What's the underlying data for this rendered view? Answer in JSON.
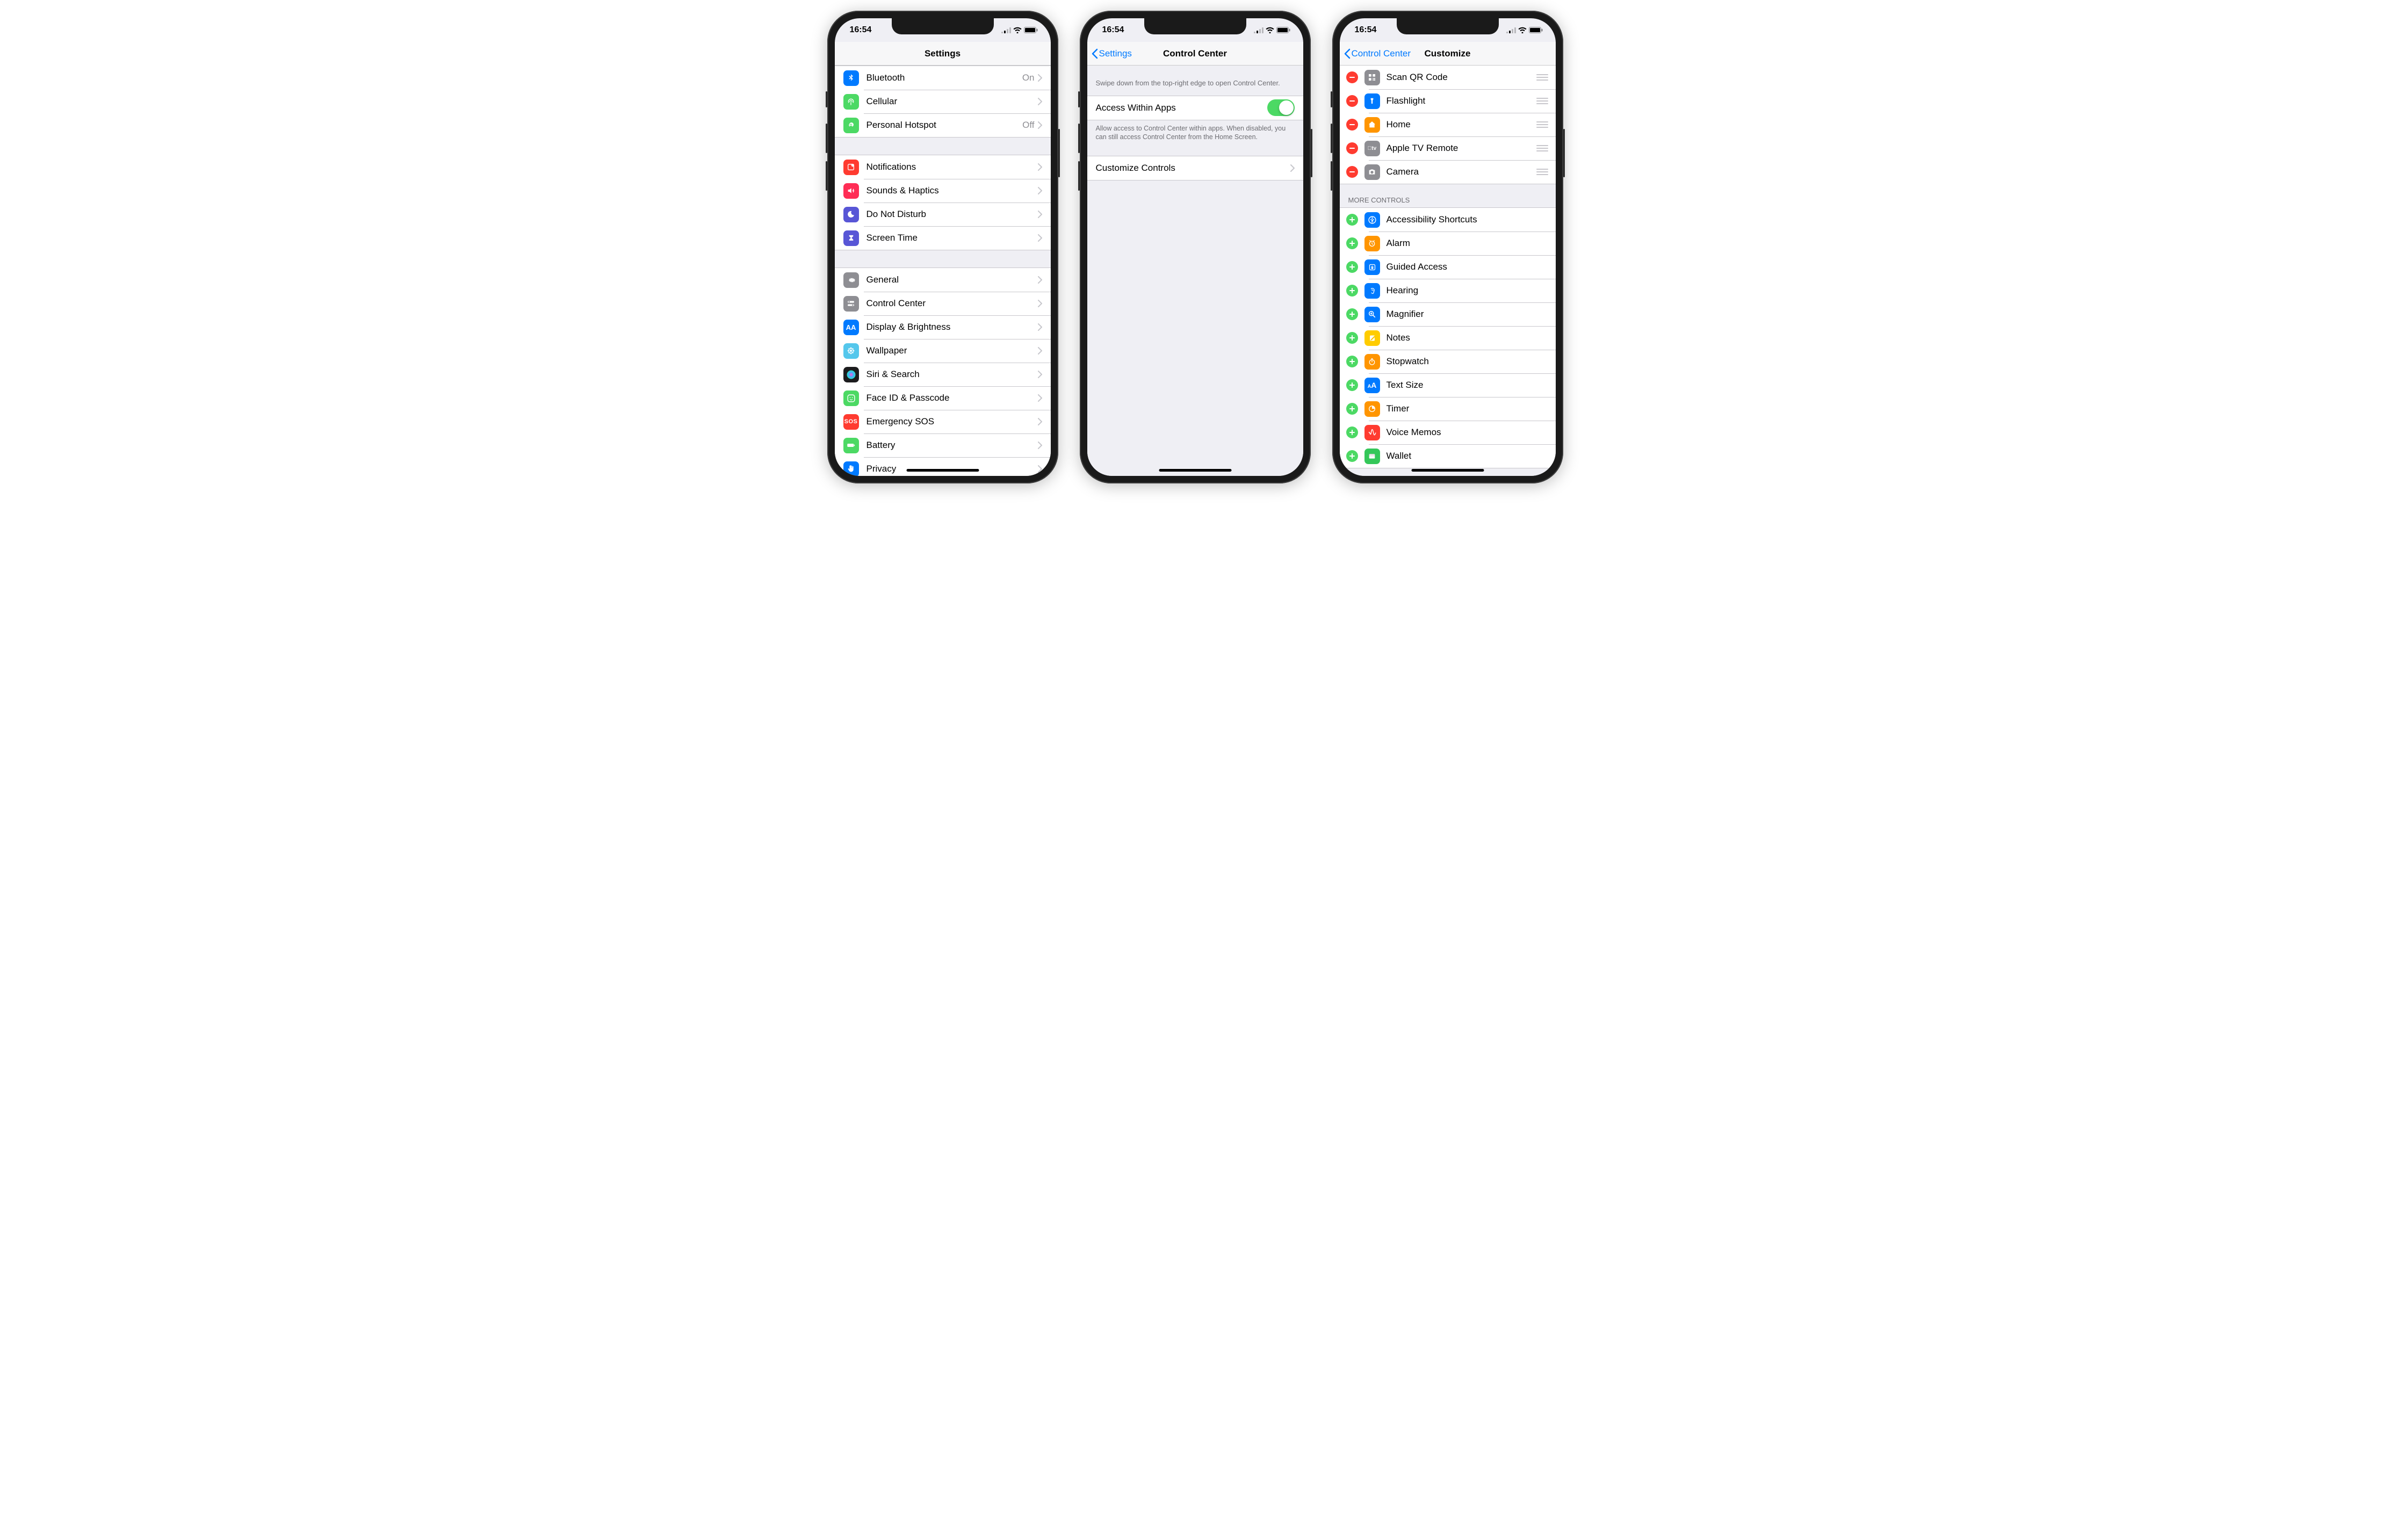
{
  "status": {
    "time": "16:54"
  },
  "screen1": {
    "title": "Settings",
    "group1": [
      {
        "label": "Bluetooth",
        "detail": "On",
        "icon": "bluetooth",
        "color": "#007aff"
      },
      {
        "label": "Cellular",
        "detail": "",
        "icon": "antenna",
        "color": "#4cd964"
      },
      {
        "label": "Personal Hotspot",
        "detail": "Off",
        "icon": "hotspot",
        "color": "#4cd964"
      }
    ],
    "group2": [
      {
        "label": "Notifications",
        "icon": "notifications",
        "color": "#ff3b30"
      },
      {
        "label": "Sounds & Haptics",
        "icon": "sound",
        "color": "#ff2d55"
      },
      {
        "label": "Do Not Disturb",
        "icon": "moon",
        "color": "#5856d6"
      },
      {
        "label": "Screen Time",
        "icon": "hourglass",
        "color": "#5856d6"
      }
    ],
    "group3": [
      {
        "label": "General",
        "icon": "gear",
        "color": "#8e8e93"
      },
      {
        "label": "Control Center",
        "icon": "switches",
        "color": "#8e8e93"
      },
      {
        "label": "Display & Brightness",
        "icon": "aa",
        "color": "#007aff"
      },
      {
        "label": "Wallpaper",
        "icon": "flower",
        "color": "#54c7ec"
      },
      {
        "label": "Siri & Search",
        "icon": "siri",
        "color": "#1c1c1e"
      },
      {
        "label": "Face ID & Passcode",
        "icon": "face",
        "color": "#4cd964"
      },
      {
        "label": "Emergency SOS",
        "icon": "sos",
        "color": "#ff3b30"
      },
      {
        "label": "Battery",
        "icon": "battery",
        "color": "#4cd964"
      },
      {
        "label": "Privacy",
        "icon": "hand",
        "color": "#007aff"
      }
    ]
  },
  "screen2": {
    "back": "Settings",
    "title": "Control Center",
    "hint": "Swipe down from the top-right edge to open Control Center.",
    "toggle_label": "Access Within Apps",
    "toggle_footer": "Allow access to Control Center within apps. When disabled, you can still access Control Center from the Home Screen.",
    "customize": "Customize Controls"
  },
  "screen3": {
    "back": "Control Center",
    "title": "Customize",
    "included": [
      {
        "label": "Scan QR Code",
        "icon": "qr",
        "color": "#8e8e93"
      },
      {
        "label": "Flashlight",
        "icon": "flashlight",
        "color": "#007aff"
      },
      {
        "label": "Home",
        "icon": "home",
        "color": "#ff9500"
      },
      {
        "label": "Apple TV Remote",
        "icon": "tvremote",
        "color": "#8e8e93"
      },
      {
        "label": "Camera",
        "icon": "camera",
        "color": "#8e8e93"
      }
    ],
    "more_header": "More Controls",
    "more": [
      {
        "label": "Accessibility Shortcuts",
        "icon": "accessibility",
        "color": "#007aff"
      },
      {
        "label": "Alarm",
        "icon": "alarm",
        "color": "#ff9500"
      },
      {
        "label": "Guided Access",
        "icon": "lock",
        "color": "#007aff"
      },
      {
        "label": "Hearing",
        "icon": "ear",
        "color": "#007aff"
      },
      {
        "label": "Magnifier",
        "icon": "magnifier",
        "color": "#007aff"
      },
      {
        "label": "Notes",
        "icon": "notes",
        "color": "#ffcc00"
      },
      {
        "label": "Stopwatch",
        "icon": "stopwatch",
        "color": "#ff9500"
      },
      {
        "label": "Text Size",
        "icon": "textsize",
        "color": "#007aff"
      },
      {
        "label": "Timer",
        "icon": "timer",
        "color": "#ff9500"
      },
      {
        "label": "Voice Memos",
        "icon": "voicememo",
        "color": "#ff3b30"
      },
      {
        "label": "Wallet",
        "icon": "wallet",
        "color": "#34c759"
      }
    ]
  }
}
